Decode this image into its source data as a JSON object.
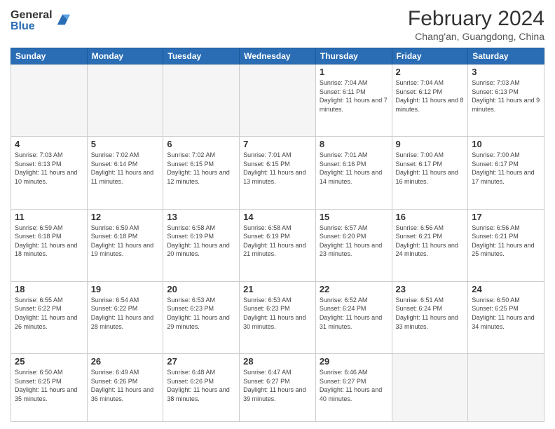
{
  "header": {
    "logo": {
      "general": "General",
      "blue": "Blue"
    },
    "title": "February 2024",
    "subtitle": "Chang'an, Guangdong, China"
  },
  "days_of_week": [
    "Sunday",
    "Monday",
    "Tuesday",
    "Wednesday",
    "Thursday",
    "Friday",
    "Saturday"
  ],
  "weeks": [
    [
      {
        "day": "",
        "info": ""
      },
      {
        "day": "",
        "info": ""
      },
      {
        "day": "",
        "info": ""
      },
      {
        "day": "",
        "info": ""
      },
      {
        "day": "1",
        "info": "Sunrise: 7:04 AM\nSunset: 6:11 PM\nDaylight: 11 hours and 7 minutes."
      },
      {
        "day": "2",
        "info": "Sunrise: 7:04 AM\nSunset: 6:12 PM\nDaylight: 11 hours and 8 minutes."
      },
      {
        "day": "3",
        "info": "Sunrise: 7:03 AM\nSunset: 6:13 PM\nDaylight: 11 hours and 9 minutes."
      }
    ],
    [
      {
        "day": "4",
        "info": "Sunrise: 7:03 AM\nSunset: 6:13 PM\nDaylight: 11 hours and 10 minutes."
      },
      {
        "day": "5",
        "info": "Sunrise: 7:02 AM\nSunset: 6:14 PM\nDaylight: 11 hours and 11 minutes."
      },
      {
        "day": "6",
        "info": "Sunrise: 7:02 AM\nSunset: 6:15 PM\nDaylight: 11 hours and 12 minutes."
      },
      {
        "day": "7",
        "info": "Sunrise: 7:01 AM\nSunset: 6:15 PM\nDaylight: 11 hours and 13 minutes."
      },
      {
        "day": "8",
        "info": "Sunrise: 7:01 AM\nSunset: 6:16 PM\nDaylight: 11 hours and 14 minutes."
      },
      {
        "day": "9",
        "info": "Sunrise: 7:00 AM\nSunset: 6:17 PM\nDaylight: 11 hours and 16 minutes."
      },
      {
        "day": "10",
        "info": "Sunrise: 7:00 AM\nSunset: 6:17 PM\nDaylight: 11 hours and 17 minutes."
      }
    ],
    [
      {
        "day": "11",
        "info": "Sunrise: 6:59 AM\nSunset: 6:18 PM\nDaylight: 11 hours and 18 minutes."
      },
      {
        "day": "12",
        "info": "Sunrise: 6:59 AM\nSunset: 6:18 PM\nDaylight: 11 hours and 19 minutes."
      },
      {
        "day": "13",
        "info": "Sunrise: 6:58 AM\nSunset: 6:19 PM\nDaylight: 11 hours and 20 minutes."
      },
      {
        "day": "14",
        "info": "Sunrise: 6:58 AM\nSunset: 6:19 PM\nDaylight: 11 hours and 21 minutes."
      },
      {
        "day": "15",
        "info": "Sunrise: 6:57 AM\nSunset: 6:20 PM\nDaylight: 11 hours and 23 minutes."
      },
      {
        "day": "16",
        "info": "Sunrise: 6:56 AM\nSunset: 6:21 PM\nDaylight: 11 hours and 24 minutes."
      },
      {
        "day": "17",
        "info": "Sunrise: 6:56 AM\nSunset: 6:21 PM\nDaylight: 11 hours and 25 minutes."
      }
    ],
    [
      {
        "day": "18",
        "info": "Sunrise: 6:55 AM\nSunset: 6:22 PM\nDaylight: 11 hours and 26 minutes."
      },
      {
        "day": "19",
        "info": "Sunrise: 6:54 AM\nSunset: 6:22 PM\nDaylight: 11 hours and 28 minutes."
      },
      {
        "day": "20",
        "info": "Sunrise: 6:53 AM\nSunset: 6:23 PM\nDaylight: 11 hours and 29 minutes."
      },
      {
        "day": "21",
        "info": "Sunrise: 6:53 AM\nSunset: 6:23 PM\nDaylight: 11 hours and 30 minutes."
      },
      {
        "day": "22",
        "info": "Sunrise: 6:52 AM\nSunset: 6:24 PM\nDaylight: 11 hours and 31 minutes."
      },
      {
        "day": "23",
        "info": "Sunrise: 6:51 AM\nSunset: 6:24 PM\nDaylight: 11 hours and 33 minutes."
      },
      {
        "day": "24",
        "info": "Sunrise: 6:50 AM\nSunset: 6:25 PM\nDaylight: 11 hours and 34 minutes."
      }
    ],
    [
      {
        "day": "25",
        "info": "Sunrise: 6:50 AM\nSunset: 6:25 PM\nDaylight: 11 hours and 35 minutes."
      },
      {
        "day": "26",
        "info": "Sunrise: 6:49 AM\nSunset: 6:26 PM\nDaylight: 11 hours and 36 minutes."
      },
      {
        "day": "27",
        "info": "Sunrise: 6:48 AM\nSunset: 6:26 PM\nDaylight: 11 hours and 38 minutes."
      },
      {
        "day": "28",
        "info": "Sunrise: 6:47 AM\nSunset: 6:27 PM\nDaylight: 11 hours and 39 minutes."
      },
      {
        "day": "29",
        "info": "Sunrise: 6:46 AM\nSunset: 6:27 PM\nDaylight: 11 hours and 40 minutes."
      },
      {
        "day": "",
        "info": ""
      },
      {
        "day": "",
        "info": ""
      }
    ]
  ]
}
